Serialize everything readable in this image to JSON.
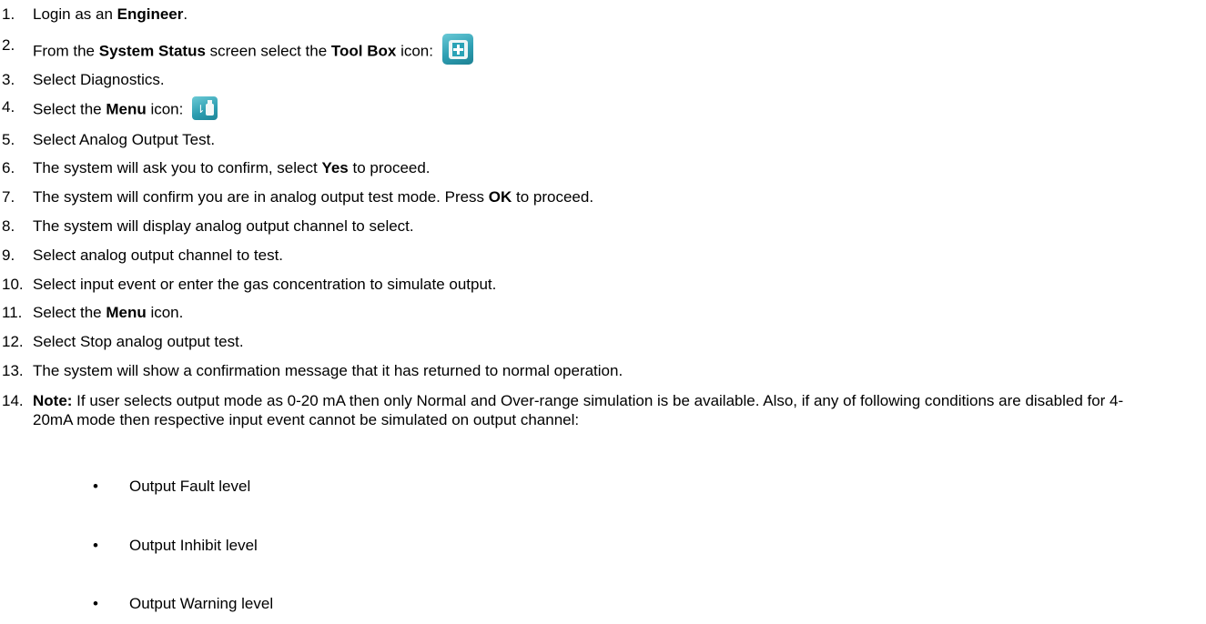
{
  "steps": [
    {
      "num": "1.",
      "parts": [
        "Login as an ",
        "Engineer",
        "."
      ]
    },
    {
      "num": "2.",
      "parts": [
        "From the ",
        "System Status",
        " screen select the ",
        "Tool Box",
        " icon:"
      ],
      "icon": "toolbox-icon"
    },
    {
      "num": "3.",
      "parts": [
        "Select Diagnostics."
      ]
    },
    {
      "num": "4.",
      "parts": [
        "Select the ",
        "Menu",
        " icon:"
      ],
      "icon": "menu-icon"
    },
    {
      "num": "5.",
      "parts": [
        "Select Analog Output Test."
      ]
    },
    {
      "num": "6.",
      "parts": [
        "The system will ask you to confirm, select ",
        "Yes",
        " to proceed."
      ]
    },
    {
      "num": "7.",
      "parts": [
        "The system will confirm you are in analog output test mode. Press ",
        "OK",
        " to proceed."
      ]
    },
    {
      "num": "8.",
      "parts": [
        "The system will display analog output channel to select."
      ]
    },
    {
      "num": "9.",
      "parts": [
        "Select analog output channel to test."
      ]
    },
    {
      "num": "10.",
      "parts": [
        "Select input event or enter the gas concentration to simulate output."
      ]
    },
    {
      "num": "11.",
      "parts": [
        "Select the ",
        "Menu",
        " icon."
      ]
    },
    {
      "num": "12.",
      "parts": [
        "Select Stop analog output test."
      ]
    },
    {
      "num": "13.",
      "parts": [
        "The system will show a confirmation message that it has returned to normal operation."
      ]
    }
  ],
  "note": {
    "num": "14.",
    "label": "Note:",
    "text": " If user selects output mode as 0-20 mA then only Normal and Over-range simulation is be available. Also, if any of following conditions are disabled for 4-20mA mode then respective input event cannot be simulated on output channel:"
  },
  "bullets": [
    "Output Fault level",
    "Output Inhibit level",
    "Output Warning level"
  ],
  "bullet_symbol": "•"
}
